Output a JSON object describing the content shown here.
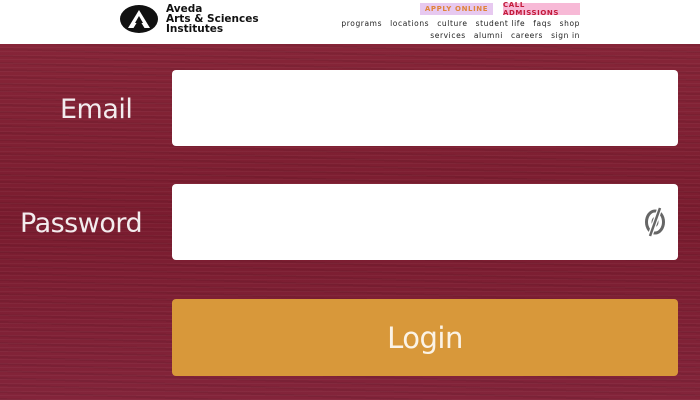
{
  "header": {
    "logo": {
      "line1": "Aveda",
      "line2": "Arts & Sciences",
      "line3": "Institutes",
      "icon": "aveda-logo-icon"
    },
    "apply_label": "APPLY ONLINE",
    "call_label": "CALL ADMISSIONS",
    "nav_primary": [
      "programs",
      "locations",
      "culture",
      "student life",
      "faqs",
      "shop"
    ],
    "nav_secondary": [
      "services",
      "alumni",
      "careers",
      "sign in"
    ]
  },
  "login": {
    "email_label": "Email",
    "email_value": "",
    "password_label": "Password",
    "password_value": "",
    "password_toggle_icon": "eye-slash-icon",
    "login_label": "Login"
  },
  "colors": {
    "panel_bg": "#7e1f31",
    "login_button": "#d8983a",
    "apply_bg": "#e7c9f0",
    "call_bg": "#f7b9d6"
  }
}
